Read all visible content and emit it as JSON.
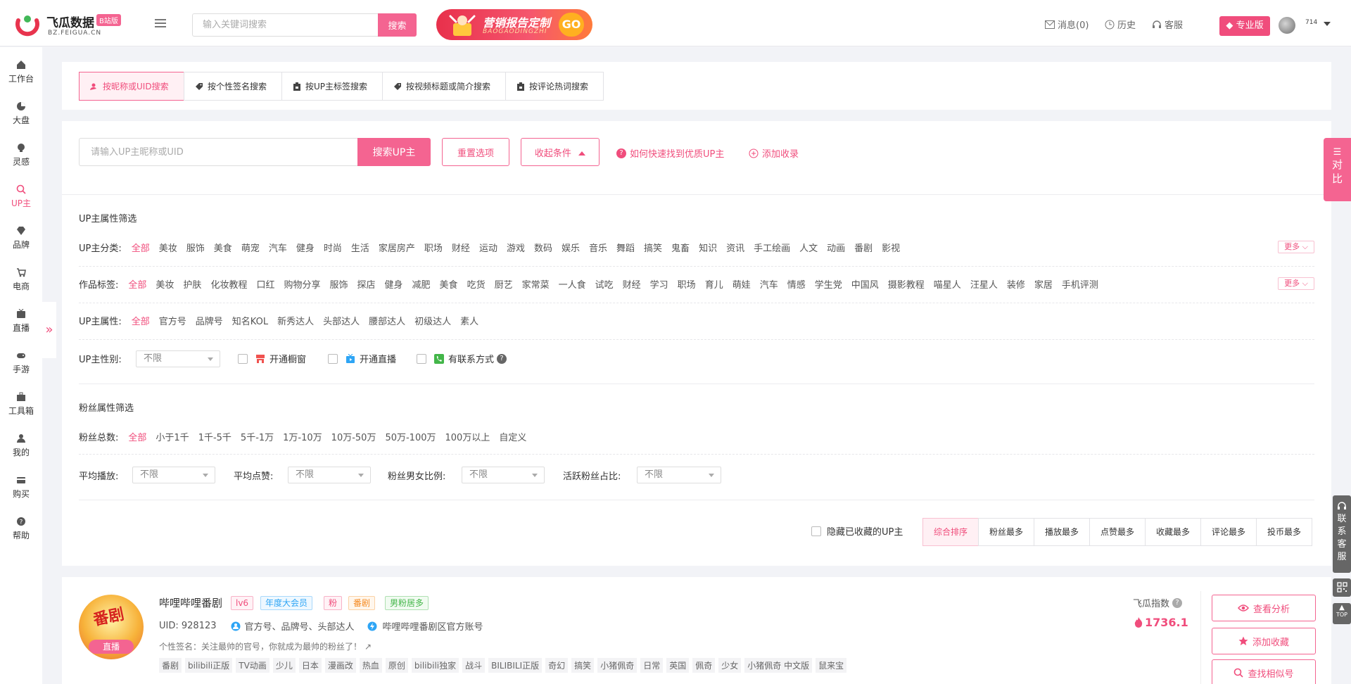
{
  "header": {
    "logo_title": "飞瓜数据",
    "logo_badge": "B站版",
    "logo_sub": "BZ.FEIGUA.CN",
    "search_placeholder": "输入关键词搜索",
    "search_button": "搜索",
    "promo_title": "营销报告定制",
    "promo_sub": "BAOGAODINGZHI",
    "promo_go": "GO",
    "nav": [
      {
        "label": "消息(0)",
        "icon": "mail-icon"
      },
      {
        "label": "历史",
        "icon": "clock-icon"
      },
      {
        "label": "客服",
        "icon": "headset-icon"
      }
    ],
    "pro_label": "专业版",
    "user_name": "714"
  },
  "sidebar": {
    "items": [
      {
        "label": "工作台",
        "icon": "home-icon"
      },
      {
        "label": "大盘",
        "icon": "pie-icon"
      },
      {
        "label": "灵感",
        "icon": "bulb-icon"
      },
      {
        "label": "UP主",
        "icon": "search-icon"
      },
      {
        "label": "品牌",
        "icon": "diamond-icon"
      },
      {
        "label": "电商",
        "icon": "cart-icon"
      },
      {
        "label": "直播",
        "icon": "tv-icon"
      },
      {
        "label": "手游",
        "icon": "gamepad-icon"
      },
      {
        "label": "工具箱",
        "icon": "toolbox-icon"
      },
      {
        "label": "我的",
        "icon": "user-icon"
      },
      {
        "label": "购买",
        "icon": "card-icon"
      },
      {
        "label": "帮助",
        "icon": "help-icon"
      }
    ],
    "active_index": 3,
    "collapse_glyph": "»"
  },
  "search_tabs": [
    {
      "label": "按昵称或UID搜索",
      "active": true
    },
    {
      "label": "按个性签名搜索",
      "active": false
    },
    {
      "label": "按UP主标签搜索",
      "active": false
    },
    {
      "label": "按视频标题或简介搜索",
      "active": false
    },
    {
      "label": "按评论热词搜索",
      "active": false
    }
  ],
  "search": {
    "placeholder": "请输入UP主昵称或UID",
    "value": "",
    "search_button": "搜索UP主",
    "reset_button": "重置选项",
    "collapse_button": "收起条件",
    "help_link": "如何快速找到优质UP主",
    "add_link": "添加收录"
  },
  "up_filters": {
    "title": "UP主属性筛选",
    "category": {
      "label": "UP主分类:",
      "options": [
        "全部",
        "美妆",
        "服饰",
        "美食",
        "萌宠",
        "汽车",
        "健身",
        "时尚",
        "生活",
        "家居房产",
        "职场",
        "财经",
        "运动",
        "游戏",
        "数码",
        "娱乐",
        "音乐",
        "舞蹈",
        "搞笑",
        "鬼畜",
        "知识",
        "资讯",
        "手工绘画",
        "人文",
        "动画",
        "番剧",
        "影视"
      ],
      "selected": 0,
      "more": "更多"
    },
    "works": {
      "label": "作品标签:",
      "options": [
        "全部",
        "美妆",
        "护肤",
        "化妆教程",
        "口红",
        "购物分享",
        "服饰",
        "探店",
        "健身",
        "减肥",
        "美食",
        "吃货",
        "厨艺",
        "家常菜",
        "一人食",
        "试吃",
        "财经",
        "学习",
        "职场",
        "育儿",
        "萌娃",
        "汽车",
        "情感",
        "学生党",
        "中国风",
        "摄影教程",
        "喵星人",
        "汪星人",
        "装修",
        "家居",
        "手机评测"
      ],
      "selected": 0,
      "more": "更多"
    },
    "attribute": {
      "label": "UP主属性:",
      "options": [
        "全部",
        "官方号",
        "品牌号",
        "知名KOL",
        "新秀达人",
        "头部达人",
        "腰部达人",
        "初级达人",
        "素人"
      ],
      "selected": 0
    },
    "gender": {
      "label": "UP主性别:",
      "value": "不限"
    },
    "checkboxes": [
      {
        "label": "开通橱窗",
        "icon": "shop-icon",
        "color": "#f0524f"
      },
      {
        "label": "开通直播",
        "icon": "live-tv-icon",
        "color": "#2ea5f5"
      },
      {
        "label": "有联系方式",
        "icon": "phone-icon",
        "color": "#43b649",
        "help": "?"
      }
    ]
  },
  "fan_filters": {
    "title": "粉丝属性筛选",
    "total": {
      "label": "粉丝总数:",
      "options": [
        "全部",
        "小于1千",
        "1千-5千",
        "5千-1万",
        "1万-10万",
        "10万-50万",
        "50万-100万",
        "100万以上",
        "自定义"
      ],
      "selected": 0
    },
    "selects": [
      {
        "label": "平均播放:",
        "value": "不限"
      },
      {
        "label": "平均点赞:",
        "value": "不限"
      },
      {
        "label": "粉丝男女比例:",
        "value": "不限"
      },
      {
        "label": "活跃粉丝占比:",
        "value": "不限"
      }
    ]
  },
  "sorting": {
    "hide_collected": "隐藏已收藏的UP主",
    "tabs": [
      "综合排序",
      "粉丝最多",
      "播放最多",
      "点赞最多",
      "收藏最多",
      "评论最多",
      "投币最多"
    ],
    "active": 0
  },
  "result": {
    "avatar_text": "番剧",
    "live_badge": "直播",
    "name": "哔哩哔哩番剧",
    "tags": [
      {
        "label": "lv6",
        "color": "#f04d7c"
      },
      {
        "label": "年度大会员",
        "color": "#2ea5f5"
      },
      {
        "label": "粉",
        "color": "#f04d7c"
      },
      {
        "label": "番剧",
        "color": "#f5891f"
      },
      {
        "label": "男粉居多",
        "color": "#43b649"
      }
    ],
    "uid_label": "UID:",
    "uid": "928123",
    "identity": "官方号、品牌号、头部达人",
    "verify": "哔哩哔哩番剧区官方账号",
    "signature": "个性签名：关注最帅的官号，你就成为最帅的粉丝了！",
    "keywords": [
      "番剧",
      "bilibili正版",
      "TV动画",
      "少儿",
      "日本",
      "漫画改",
      "热血",
      "原创",
      "bilibili独家",
      "战斗",
      "BILIBILI正版",
      "奇幻",
      "搞笑",
      "小猪佩奇",
      "日常",
      "英国",
      "佩奇",
      "少女",
      "小猪佩奇 中文版",
      "鼠来宝"
    ],
    "index_label": "飞瓜指数",
    "index_value": "1736.1",
    "actions": [
      {
        "label": "查看分析",
        "icon": "eye-icon"
      },
      {
        "label": "添加收藏",
        "icon": "star-icon"
      },
      {
        "label": "查找相似号",
        "icon": "search-icon"
      }
    ]
  },
  "float": {
    "compare": [
      "对",
      "比"
    ],
    "service": [
      "联",
      "系",
      "客",
      "服"
    ],
    "top": "TOP"
  },
  "colors": {
    "accent": "#f46491",
    "accent_text": "#f04d7c"
  }
}
